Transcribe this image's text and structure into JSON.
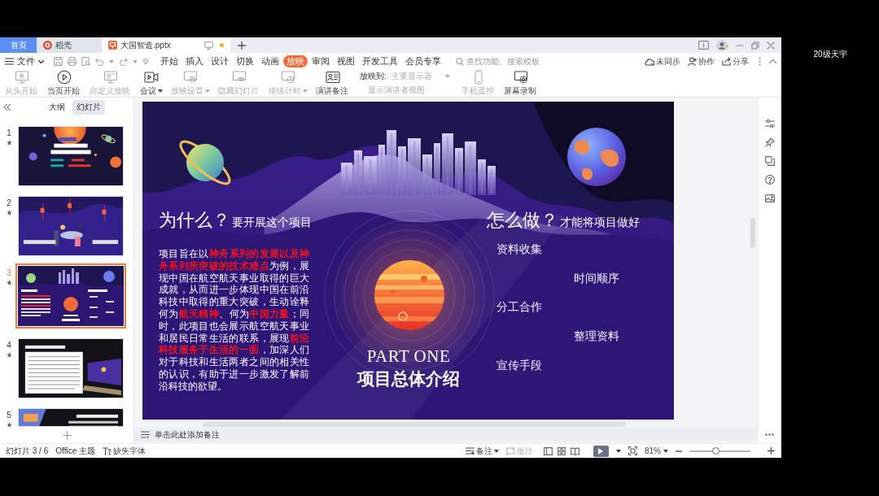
{
  "tabs": [
    {
      "kind": "home",
      "label": "首页",
      "selected": false,
      "unsaved": false
    },
    {
      "kind": "docer",
      "label": "稻壳",
      "selected": false,
      "unsaved": false
    },
    {
      "kind": "file",
      "label": "大国智造.pptx",
      "selected": true,
      "unsaved": true
    }
  ],
  "menu": {
    "file": {
      "label": "文件"
    },
    "tabs": [
      {
        "label": "开始",
        "selected": false
      },
      {
        "label": "插入",
        "selected": false
      },
      {
        "label": "设计",
        "selected": false
      },
      {
        "label": "切换",
        "selected": false
      },
      {
        "label": "动画",
        "selected": false
      },
      {
        "label": "放映",
        "selected": true
      },
      {
        "label": "审阅",
        "selected": false
      },
      {
        "label": "视图",
        "selected": false
      },
      {
        "label": "开发工具",
        "selected": false
      },
      {
        "label": "会员专享",
        "selected": false
      }
    ],
    "search": {
      "placeholder": "查找功能、搜索模板"
    },
    "actions": [
      {
        "kind": "sync",
        "label": "未同步"
      },
      {
        "kind": "collaborate",
        "label": "协作"
      },
      {
        "kind": "share",
        "label": "分享"
      }
    ]
  },
  "ribbon": {
    "items": [
      {
        "kind": "button",
        "label": "从头开始",
        "disabled": true,
        "dropdown": false
      },
      {
        "kind": "button",
        "label": "当页开始",
        "disabled": false,
        "dropdown": false
      },
      {
        "kind": "button",
        "label": "自定义放映",
        "disabled": true,
        "dropdown": false
      },
      {
        "kind": "button",
        "label": "会议",
        "disabled": false,
        "dropdown": true
      },
      {
        "kind": "button",
        "label": "放映设置",
        "disabled": true,
        "dropdown": true
      },
      {
        "kind": "button",
        "label": "隐藏幻灯片",
        "disabled": true,
        "dropdown": false
      },
      {
        "kind": "button",
        "label": "排练计时",
        "disabled": true,
        "dropdown": true
      },
      {
        "kind": "button",
        "label": "演讲备注",
        "disabled": false,
        "dropdown": false
      },
      {
        "kind": "display",
        "label": "放映到:",
        "value": "主要显示器",
        "option": "显示演讲者视图",
        "disabled": true
      },
      {
        "kind": "button",
        "label": "手机遥控",
        "disabled": true,
        "dropdown": false
      },
      {
        "kind": "button",
        "label": "屏幕录制",
        "disabled": false,
        "dropdown": false
      }
    ]
  },
  "panel": {
    "tabs": [
      {
        "label": "大纲",
        "selected": false
      },
      {
        "label": "幻灯片",
        "selected": true
      }
    ],
    "slides": [
      {
        "number": "1",
        "selected": false
      },
      {
        "number": "2",
        "selected": false
      },
      {
        "number": "3",
        "selected": true
      },
      {
        "number": "4",
        "selected": false
      },
      {
        "number": "5",
        "selected": false
      }
    ]
  },
  "slide": {
    "why": {
      "title": "为什么？",
      "subtitle": "要开展这个项目",
      "body": "项目旨在以**神舟系列的发展以及神舟系列所突破的技术难点**为例，展现中国在航空航天事业取得的巨大成就，从而进一步体现中国在前沿科技中取得的重大突破，生动诠释何为**航天精神**、何为**中国力量**；同时，此项目也会展示航空航天事业和居民日常生活的联系，展现**前沿科技服务于生活的一面**，加深人们对于科技和生活两者之间的相关性的认识，有助于进一步激发了解前沿科技的欲望。"
    },
    "how": {
      "title": "怎么做？",
      "subtitle": "才能将项目做好",
      "items": [
        "资料收集",
        "时间顺序",
        "分工合作",
        "整理资料",
        "宣传手段"
      ]
    },
    "part": {
      "label": "PART ONE",
      "title": "项目总体介绍"
    }
  },
  "notes": {
    "placeholder": "单击此处添加备注"
  },
  "status_bar": {
    "slide_counter": "幻灯片 3 / 6",
    "theme": "Office 主题",
    "missing_fonts": "缺失字体",
    "buttons": [
      {
        "label": "备注",
        "disabled": false,
        "dropdown": true
      },
      {
        "label": "批注",
        "disabled": true,
        "dropdown": false
      }
    ],
    "zoom": {
      "value": "81%",
      "level": 0.43
    }
  },
  "participant_name": "20级天宇"
}
